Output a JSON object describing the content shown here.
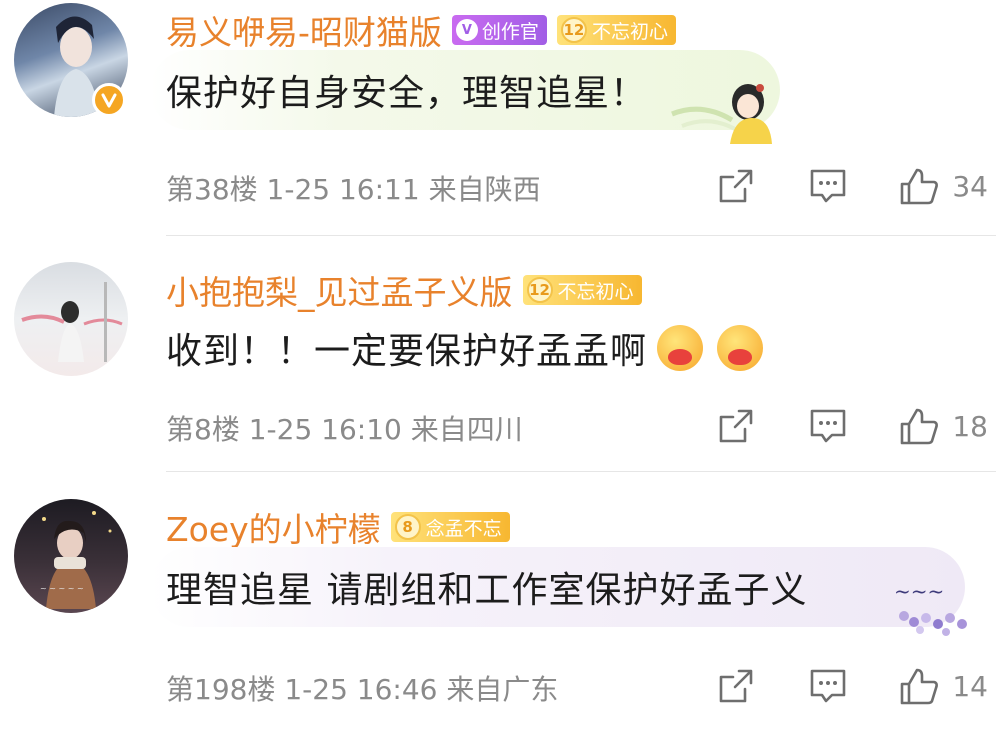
{
  "comments": [
    {
      "username": "易义咿易-昭财猫版",
      "badges": [
        {
          "type": "creator",
          "text": "创作官"
        },
        {
          "type": "fan",
          "level": "12",
          "text": "不忘初心"
        }
      ],
      "verified": true,
      "text": "保护好自身安全，理智追星！",
      "meta": "第38楼 1-25 16:11 来自陕西",
      "likes": "34",
      "bubble_color": "#f1f8e4"
    },
    {
      "username": "小抱抱梨_见过孟子义版",
      "badges": [
        {
          "type": "fan",
          "level": "12",
          "text": "不忘初心"
        }
      ],
      "verified": false,
      "text": "收到！！一定要保护好孟孟啊",
      "emoji_count": 2,
      "meta": "第8楼 1-25 16:10 来自四川",
      "likes": "18"
    },
    {
      "username": "Zoey的小柠檬",
      "badges": [
        {
          "type": "fan",
          "level": "8",
          "text": "念孟不忘"
        }
      ],
      "verified": false,
      "text": "理智追星 请剧组和工作室保护好孟子义",
      "meta": "第198楼 1-25 16:46 来自广东",
      "likes": "14",
      "bubble_color": "#f3eef8"
    }
  ],
  "icons": {
    "share": "share-icon",
    "comment": "comment-icon",
    "like": "thumbs-up-icon",
    "verified": "verified-v-icon"
  },
  "colors": {
    "username": "#e8822c",
    "meta": "#8a8a8a",
    "text": "#1c1c1c"
  }
}
